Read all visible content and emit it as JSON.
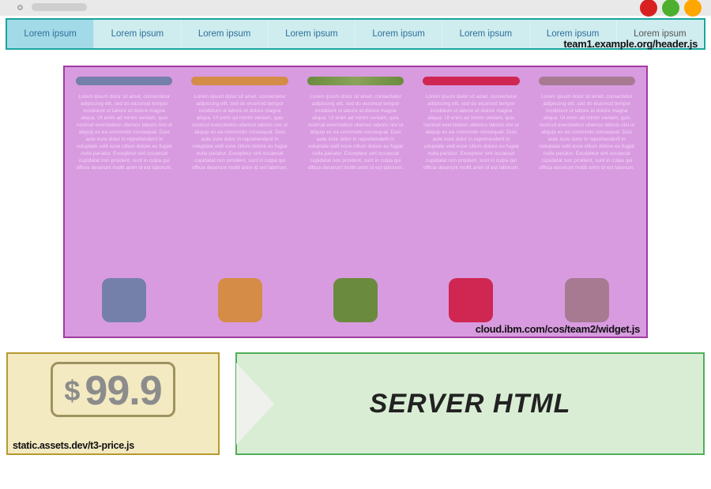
{
  "chrome": {
    "traffic_colors": [
      "#d92020",
      "#4caf2e",
      "#ffa600"
    ]
  },
  "header": {
    "source_label": "team1.example.org/header.js",
    "tabs": [
      {
        "label": "Lorem ipsum",
        "active": true
      },
      {
        "label": "Lorem ipsum",
        "active": false
      },
      {
        "label": "Lorem ipsum",
        "active": false
      },
      {
        "label": "Lorem ipsum",
        "active": false
      },
      {
        "label": "Lorem ipsum",
        "active": false
      },
      {
        "label": "Lorem ipsum",
        "active": false
      },
      {
        "label": "Lorem ipsum",
        "active": false
      },
      {
        "label": "Lorem ipsum",
        "active": false
      }
    ]
  },
  "widget": {
    "source_label": "cloud.ibm.com/cos/team2/widget.js",
    "columns": [
      {
        "color_name": "blue",
        "color": "#7480a9"
      },
      {
        "color_name": "orange",
        "color": "#d48c46"
      },
      {
        "color_name": "green",
        "color": "#6a8b3d"
      },
      {
        "color_name": "red",
        "color": "#cf2752"
      },
      {
        "color_name": "mauve",
        "color": "#a77a92"
      }
    ],
    "placeholder_text": "Lorem ipsum dolor sit amet, consectetur adipiscing elit, sed do eiusmod tempor incididunt ut labore et dolore magna aliqua. Ut enim ad minim veniam, quis nostrud exercitation ullamco laboris nisi ut aliquip ex ea commodo consequat. Duis aute irure dolor in reprehenderit in voluptate velit esse cillum dolore eu fugiat nulla pariatur. Excepteur sint occaecat cupidatat non proident, sunt in culpa qui officia deserunt mollit anim id est laborum."
  },
  "price": {
    "source_label": "static.assets.dev/t3-price.js",
    "currency": "$",
    "value": "99.9"
  },
  "server": {
    "label": "SERVER HTML"
  }
}
